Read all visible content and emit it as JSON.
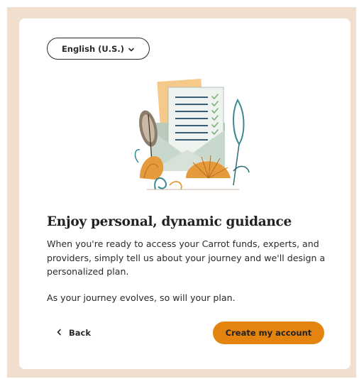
{
  "language_selector": {
    "label": "English (U.S.)",
    "icon": "chevron-down-icon"
  },
  "content": {
    "heading": "Enjoy personal, dynamic guidance",
    "paragraph_1": "When you're ready to access your Carrot funds, experts, and providers, simply tell us about your journey and we'll design a personalized plan.",
    "paragraph_2": "As your journey evolves, so will your plan."
  },
  "actions": {
    "back_label": "Back",
    "back_icon": "chevron-left-icon",
    "primary_label": "Create my account"
  },
  "colors": {
    "backdrop": "#f0dfcf",
    "primary_button": "#e5830f",
    "text": "#2a2a2a"
  }
}
